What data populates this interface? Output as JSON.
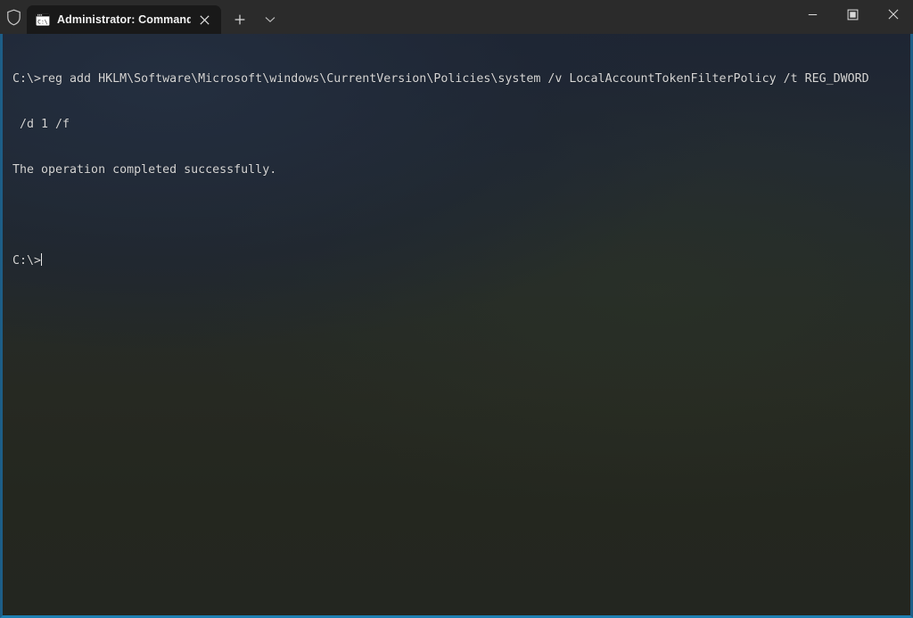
{
  "window": {
    "title": "Administrator: Command Prompt",
    "accent_border_color": "#1d7fb3",
    "titlebar_color": "#2b2b2b",
    "console_bg_color": "#1e2430",
    "console_text_color": "#d6d6d6"
  },
  "titlebar": {
    "shield_icon": "shield-icon",
    "new_tab_label": "+",
    "dropdown_label": "v",
    "minimize_label": "—",
    "maximize_label": "❑",
    "close_label": "✕"
  },
  "tabs": [
    {
      "label": "Administrator: Command Pror",
      "icon": "command-prompt-icon",
      "active": true,
      "close_label": "✕"
    }
  ],
  "console": {
    "lines": [
      "C:\\>reg add HKLM\\Software\\Microsoft\\windows\\CurrentVersion\\Policies\\system /v LocalAccountTokenFilterPolicy /t REG_DWORD",
      " /d 1 /f",
      "The operation completed successfully.",
      "",
      "C:\\>"
    ],
    "prompt": "C:\\>",
    "command": "reg add HKLM\\Software\\Microsoft\\windows\\CurrentVersion\\Policies\\system /v LocalAccountTokenFilterPolicy /t REG_DWORD /d 1 /f",
    "result": "The operation completed successfully."
  }
}
